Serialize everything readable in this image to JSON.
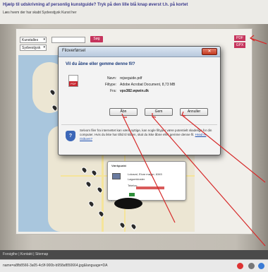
{
  "header": {
    "question": "Hjælp til udskrivning af personlig kunstguide? Tryk på den lille blå knap øverst t.h. på kortet",
    "instruction": "Læs hvem der har skabt Sydvestjysk Kunst her"
  },
  "filters": {
    "kunst_select": "Kunstalles",
    "region_select": "Sydvestjysk",
    "search_placeholder": "",
    "search_button": "Søg",
    "pdf_button": "PDF",
    "gpx_button": "GPX"
  },
  "dialog": {
    "title": "Filoverførsel",
    "question": "Vil du åbne eller gemme denne fil?",
    "icon_label": "PDF",
    "name_label": "Navn:",
    "name_value": "rejseguide.pdf",
    "type_label": "Filtype:",
    "type_value": "Adobe Acrobat Document, 8,73 MB",
    "from_label": "Fra:",
    "from_value": "vps382.wpwin.dk",
    "open_button": "Åbn",
    "save_button": "Gem",
    "cancel_button": "Annuller",
    "warning_text": "Selvom filer fra internettet kan være nyttige, kan nogle filtyper være potentielt skadelige for din computer. Hvis du ikke har tillid til kilden, skal du ikke åbne eller gemme denne fil.",
    "warning_link": "Hvad er risikoen?"
  },
  "popup": {
    "title": "Værkpunkt",
    "line1": "Lokaval, Elvar møger, 6345",
    "line2": "Løgumkloster",
    "line3": "Telefon:"
  },
  "footer": {
    "links": "Forsigthe | Kontakt | Sitemap"
  },
  "status": {
    "url": "name=a8fb8566-3a05-4c9f-900b-b958af850664.jpg&language=DA"
  },
  "colors": {
    "accent": "#c6355d",
    "link": "#1d4fb0",
    "annotation_arrow": "#d62a2a"
  }
}
